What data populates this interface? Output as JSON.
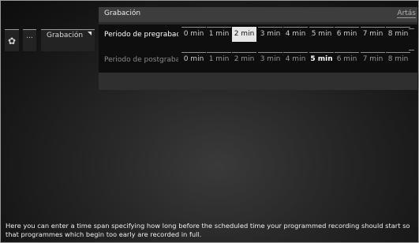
{
  "sidebar": {
    "gear_icon": "gear-icon",
    "dots_label": "...",
    "menu_label": "Grabación"
  },
  "panel": {
    "title": "Grabación",
    "right_label": "Artás",
    "rows": [
      {
        "label": "Periodo de pregrabación",
        "options": [
          "0 min",
          "1 min",
          "2 min",
          "3 min",
          "4 min",
          "5 min",
          "6 min",
          "7 min",
          "8 min"
        ],
        "selected": "2 min"
      },
      {
        "label": "Periodo de postgrabación",
        "options": [
          "0 min",
          "1 min",
          "2 min",
          "3 min",
          "4 min",
          "5 min",
          "6 min",
          "7 min",
          "8 min"
        ],
        "selected": "5 min"
      }
    ]
  },
  "help_text": "Here you can enter a time span specifying how long before the scheduled time your programmed recording should start so that programmes which begin too early are recorded in full."
}
